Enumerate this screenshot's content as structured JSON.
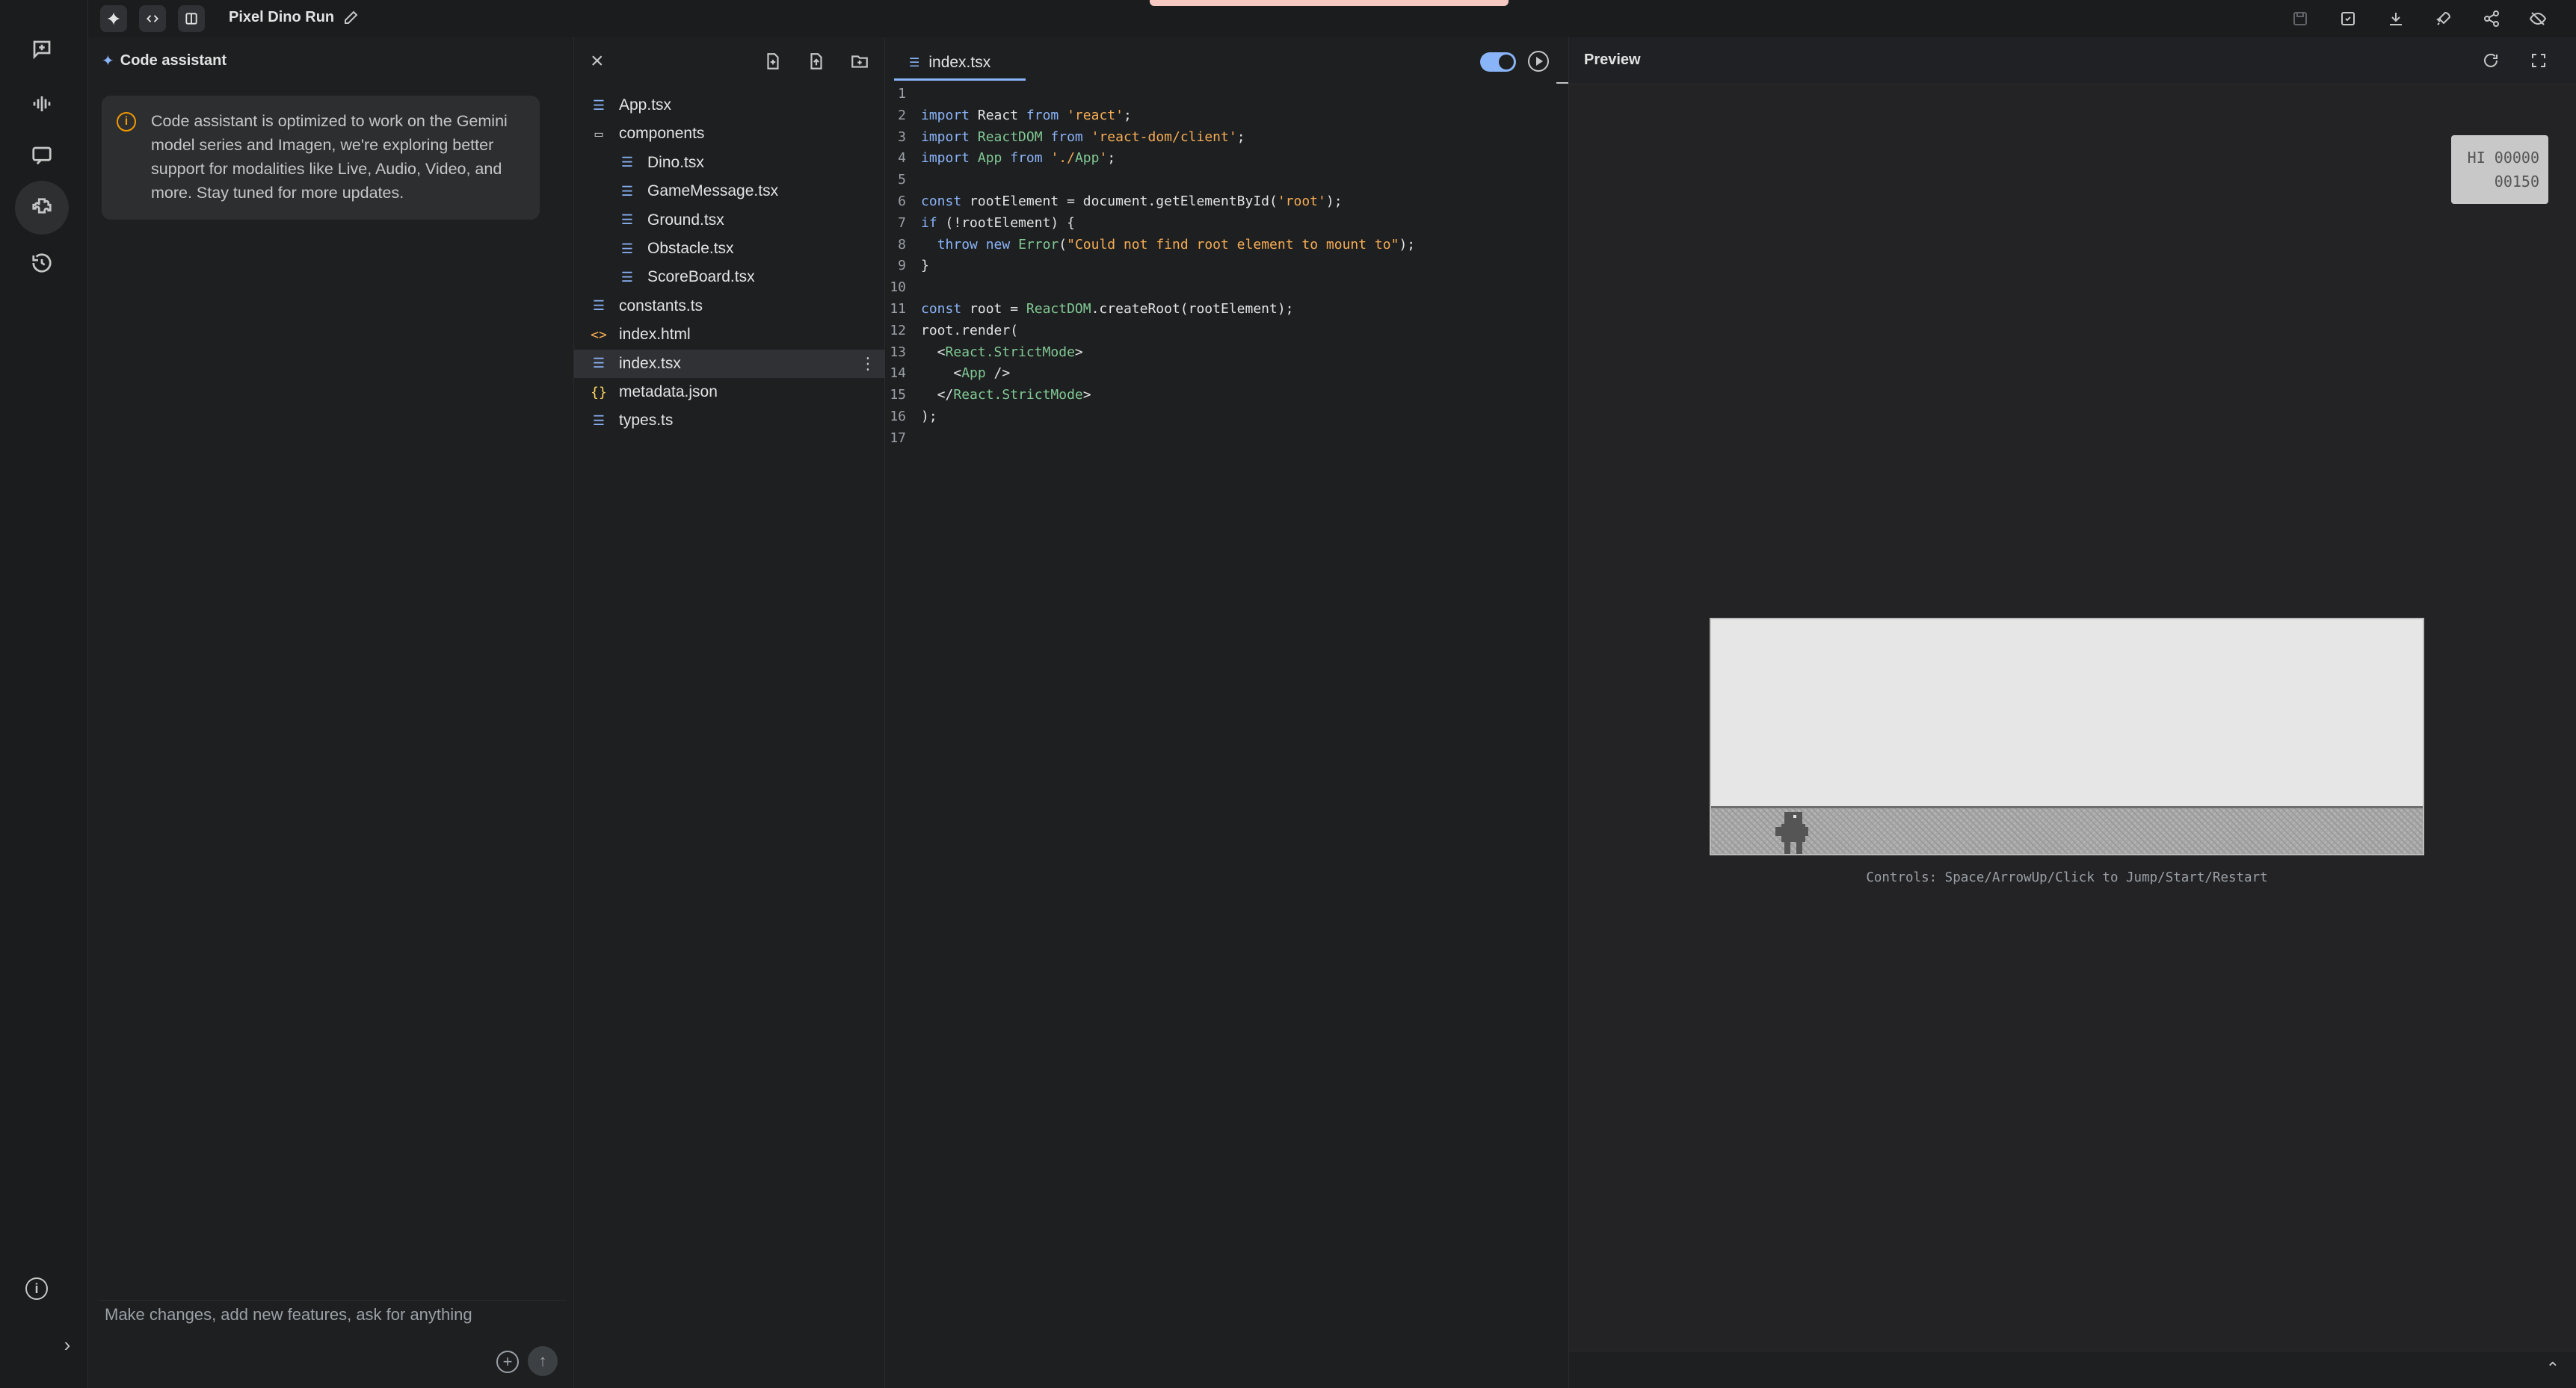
{
  "app": {
    "title": "Pixel Dino Run"
  },
  "assistant": {
    "title": "Code assistant",
    "notice": "Code assistant is optimized to work on the Gemini model series and Imagen, we're exploring better support for modalities like Live, Audio, Video, and more. Stay tuned for more updates.",
    "input_placeholder": "Make changes, add new features, ask for anything"
  },
  "files": [
    {
      "name": "App.tsx",
      "type": "ts",
      "indent": 0
    },
    {
      "name": "components",
      "type": "folder",
      "indent": 0
    },
    {
      "name": "Dino.tsx",
      "type": "ts",
      "indent": 1
    },
    {
      "name": "GameMessage.tsx",
      "type": "ts",
      "indent": 1
    },
    {
      "name": "Ground.tsx",
      "type": "ts",
      "indent": 1
    },
    {
      "name": "Obstacle.tsx",
      "type": "ts",
      "indent": 1
    },
    {
      "name": "ScoreBoard.tsx",
      "type": "ts",
      "indent": 1
    },
    {
      "name": "constants.ts",
      "type": "ts",
      "indent": 0
    },
    {
      "name": "index.html",
      "type": "html",
      "indent": 0
    },
    {
      "name": "index.tsx",
      "type": "ts",
      "indent": 0,
      "selected": true
    },
    {
      "name": "metadata.json",
      "type": "json",
      "indent": 0
    },
    {
      "name": "types.ts",
      "type": "ts",
      "indent": 0
    }
  ],
  "editor": {
    "tab": "index.tsx",
    "lines": [
      "",
      "import React from 'react';",
      "import ReactDOM from 'react-dom/client';",
      "import App from './App';",
      "",
      "const rootElement = document.getElementById('root');",
      "if (!rootElement) {",
      "  throw new Error(\"Could not find root element to mount to\");",
      "}",
      "",
      "const root = ReactDOM.createRoot(rootElement);",
      "root.render(",
      "  <React.StrictMode>",
      "    <App />",
      "  </React.StrictMode>",
      ");",
      ""
    ]
  },
  "preview": {
    "title": "Preview",
    "score_hi": "HI 00000",
    "score_current": "00150",
    "controls": "Controls: Space/ArrowUp/Click to Jump/Start/Restart"
  }
}
